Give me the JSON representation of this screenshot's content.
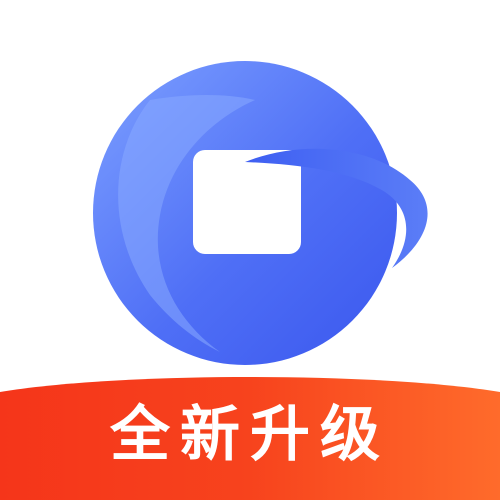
{
  "app_icon": {
    "icon_name": "app-logo-icon",
    "brand_colors": {
      "blue_light": "#6f93ff",
      "blue_dark": "#3b5cf0",
      "white": "#ffffff",
      "ribbon_red": "#f23a18",
      "ribbon_orange": "#ff6a2a"
    }
  },
  "badge": {
    "label": "全新升级"
  }
}
